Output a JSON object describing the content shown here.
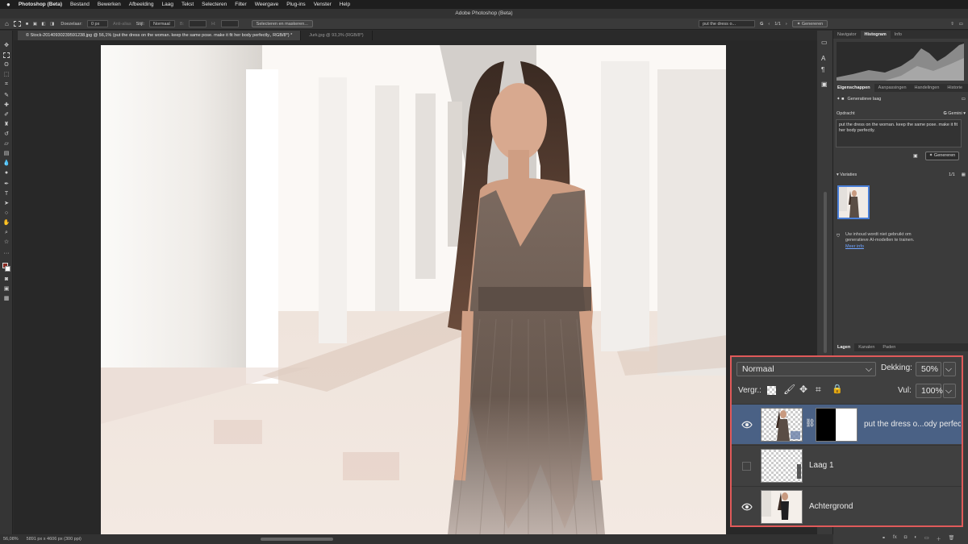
{
  "menubar": {
    "app": "Photoshop (Beta)",
    "items": [
      "Bestand",
      "Bewerken",
      "Afbeelding",
      "Laag",
      "Tekst",
      "Selecteren",
      "Filter",
      "Weergave",
      "Plug-ins",
      "Venster",
      "Help"
    ]
  },
  "title": "Adobe Photoshop (Beta)",
  "options": {
    "feather_label": "Doezelaar:",
    "feather_value": "0 px",
    "antialias": "Anti-alias",
    "style_label": "Stijl:",
    "style_value": "Normaal",
    "w_label": "B:",
    "h_label": "H:",
    "select_mask": "Selecteren en maskeren...",
    "prompt_preview": "put the dress o...",
    "variation_count": "1/1",
    "generate": "Genereren"
  },
  "tabs": [
    "© Stock-20140930239591238.jpg @ 56,1% (put the dress on the woman. keep the same pose. make it fit her body perfectly., RGB/8*) *",
    "Jurk.jpg @ 93,3% (RGB/8*)"
  ],
  "status": {
    "zoom": "56,08%",
    "dims": "5891 px x 4606 px (300 ppi)"
  },
  "panels": {
    "top_tabs": [
      "Navigator",
      "Histogram",
      "Info"
    ],
    "props_tabs": [
      "Eigenschappen",
      "Aanpassingen",
      "Handelingen",
      "Historie"
    ],
    "layer_type": "Generatieve laag",
    "prompt_label": "Opdracht",
    "model": "Gemini",
    "prompt_text": "put the dress on the woman. keep the same pose. make it fit her body perfectly.",
    "generate": "Genereren",
    "variations_label": "Variaties",
    "variations_count": "1/1",
    "ai_notice": "Uw inhoud wordt niet gebruikt om generatieve AI-modellen te trainen.",
    "more_info": "Meer info",
    "layers_tabs": [
      "Lagen",
      "Kanalen",
      "Paden"
    ]
  },
  "layers": {
    "blend_mode": "Normaal",
    "opacity_label": "Dekking:",
    "opacity_value": "50%",
    "lock_label": "Vergr.:",
    "fill_label": "Vul:",
    "fill_value": "100%",
    "items": [
      {
        "name": "put the dress o...ody perfec",
        "visible": true,
        "selected": true
      },
      {
        "name": "Laag 1",
        "visible": false,
        "selected": false
      },
      {
        "name": "Achtergrond",
        "visible": true,
        "selected": false
      }
    ]
  },
  "colors": {
    "highlight_border": "#e05a5a",
    "selected_layer": "#4a6185",
    "generate_button": "#2a72d6"
  }
}
